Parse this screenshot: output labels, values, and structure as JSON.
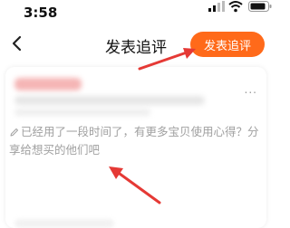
{
  "status_bar": {
    "time": "3:58"
  },
  "nav": {
    "title": "发表追评",
    "publish_button": "发表追评"
  },
  "review": {
    "more": "...",
    "placeholder": "已经用了一段时间了，有更多宝贝使用心得？分享给想买的他们吧"
  },
  "colors": {
    "accent": "#ff6a1a",
    "annotation_arrow": "#e53935"
  },
  "icons": [
    "back-icon",
    "signal-icon",
    "wifi-icon",
    "battery-icon",
    "pencil-icon"
  ]
}
